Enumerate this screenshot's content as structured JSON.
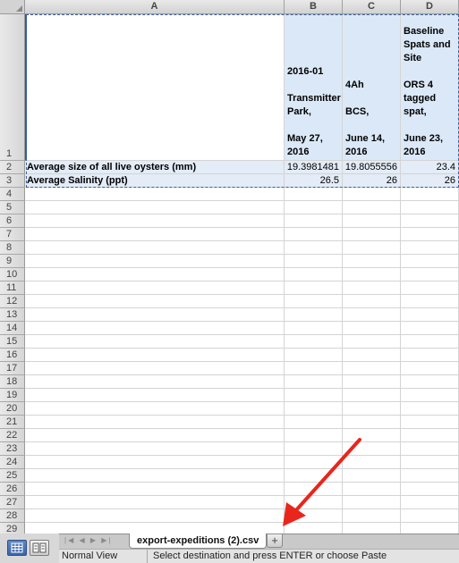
{
  "columns": [
    "A",
    "B",
    "C",
    "D"
  ],
  "headers": {
    "B": "2016-01\n\nTransmitter\nPark,\n\nMay 27,\n2016",
    "C": "4Ah\n\nBCS,\n\nJune 14,\n2016",
    "D": "Baseline\nSpats and\nSite\n\nORS 4\ntagged\nspat,\n\nJune 23,\n2016"
  },
  "rows": [
    {
      "label": "Average size of all live oysters (mm)",
      "b": "19.3981481",
      "c": "19.8055556",
      "d": "23.4"
    },
    {
      "label": "Average Salinity (ppt)",
      "b": "26.5",
      "c": "26",
      "d": "26"
    }
  ],
  "row_numbers": [
    "1",
    "2",
    "3",
    "4",
    "5",
    "6",
    "7",
    "8",
    "9",
    "10",
    "11",
    "12",
    "13",
    "14",
    "15",
    "16",
    "17",
    "18",
    "19",
    "20",
    "21",
    "22",
    "23",
    "24",
    "25",
    "26",
    "27",
    "28",
    "29"
  ],
  "sheet_tab": "export-expeditions (2).csv",
  "add_sheet": "+",
  "nav_arrows": "|◀ ◀ ▶ ▶|",
  "status": {
    "view": "Normal View",
    "message": "Select destination and press ENTER or choose Paste"
  },
  "colors": {
    "selection": "#dbe8f7",
    "arrow": "#e8261c"
  }
}
